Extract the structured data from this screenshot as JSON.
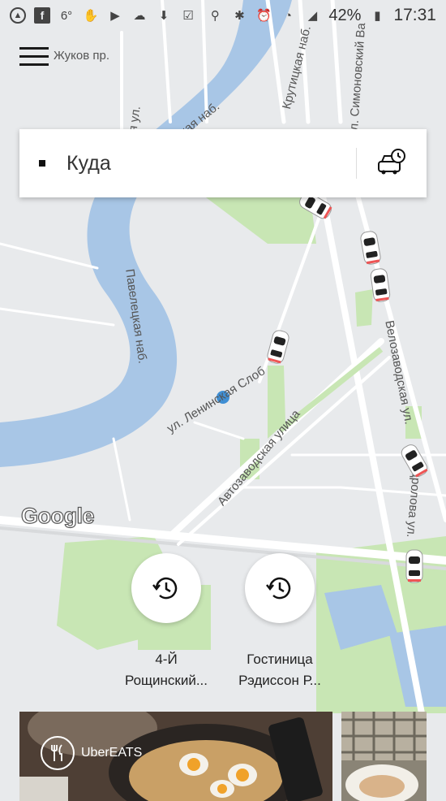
{
  "status_bar": {
    "left_icons": [
      "warning-icon",
      "facebook-icon",
      "temperature-icon",
      "hand-icon",
      "play-icon",
      "weather-icon",
      "download-icon",
      "clipboard-icon"
    ],
    "temperature": "6°",
    "battery": "42%",
    "time": "17:31"
  },
  "search": {
    "placeholder": "Куда"
  },
  "map": {
    "streets": {
      "zhukov": "Жуков пр.",
      "pavel": "евская ул.",
      "naberezh": "евская наб.",
      "krutitskaya": "Крутицкая наб.",
      "simonovsky": "л. Симоновский Ва",
      "paveletskaya": "Павелецкая наб.",
      "leninskaya": "ул. Ленинская Слоб",
      "avtozavodskaya": "Автозаводская улица",
      "velozavodskaya": "Велозаводская ул.",
      "dubrovka": "дролова ул."
    },
    "logo": "Google"
  },
  "recent": [
    {
      "line1": "4-Й",
      "line2": "Рощинский..."
    },
    {
      "line1": "Гостиница",
      "line2": "Рэдиссон Р..."
    }
  ],
  "eats": {
    "brand": "UberEATS"
  },
  "colors": {
    "map_bg": "#e8eaec",
    "river": "#a8c6e6",
    "park": "#c8e6b4",
    "road": "#ffffff",
    "user_dot": "#3f8fd4"
  }
}
